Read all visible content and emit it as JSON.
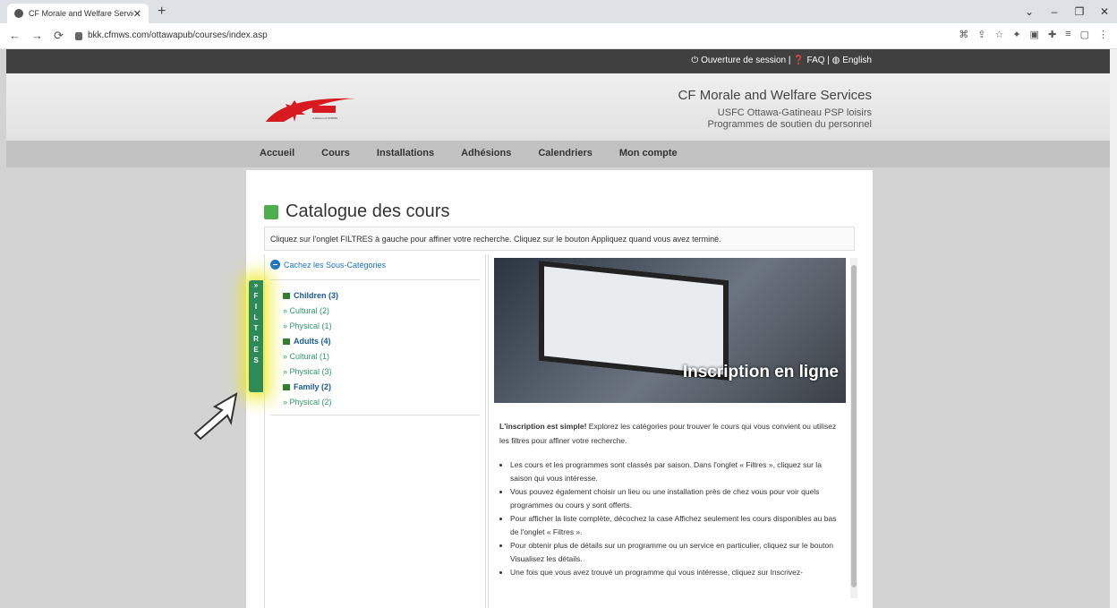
{
  "browser": {
    "tab_title": "CF Morale and Welfare Services",
    "url": "bkk.cfmws.com/ottawapub/courses/index.asp"
  },
  "topbar": {
    "login": "⏻ Ouverture de session",
    "faq": "❓ FAQ",
    "english": "English"
  },
  "header": {
    "org_line1": "CF Morale and Welfare Services",
    "org_line2": "USFC Ottawa-Gatineau PSP loisirs",
    "org_line3": "Programmes de soutien du personnel",
    "logo_small": "A division of CFMWS / Une division des SBMFC"
  },
  "nav": [
    "Accueil",
    "Cours",
    "Installations",
    "Adhésions",
    "Calendriers",
    "Mon compte"
  ],
  "main": {
    "title": "Catalogue des cours",
    "instruction": "Cliquez sur l'onglet FILTRES à gauche pour affiner votre recherche. Cliquez sur le bouton Appliquez quand vous avez terminé.",
    "hide_subcategories": "Cachez les Sous-Catégories",
    "filters_letters": [
      "»",
      "F",
      "I",
      "L",
      "T",
      "R",
      "E",
      "S"
    ],
    "categories": [
      {
        "label": "Children (3)",
        "subs": [
          "» Cultural (2)",
          "» Physical (1)"
        ]
      },
      {
        "label": "Adults (4)",
        "subs": [
          "» Cultural (1)",
          "» Physical (3)"
        ]
      },
      {
        "label": "Family (2)",
        "subs": [
          "» Physical (2)"
        ]
      }
    ],
    "hero_caption": "Inscription en ligne",
    "intro_bold": "L'inscription est simple!",
    "intro_rest": " Explorez les catégories pour trouver le cours qui vous convient ou utilisez les filtres pour affiner votre recherche.",
    "bullets": [
      "Les cours et les programmes sont classés par saison. Dans l'onglet « Filtres », cliquez sur la saison qui vous intéresse.",
      "Vous pouvez également choisir un lieu ou une installation près de chez vous pour voir quels programmes ou cours y sont offerts.",
      "Pour afficher la liste complète, décochez la case Affichez seulement les cours disponibles au bas de l'onglet « Filtres ».",
      "Pour obtenir plus de détails sur un programme ou un service en particulier, cliquez sur le bouton Visualisez les détails.",
      "Une fois que vous avez trouvé un programme qui vous intéresse, cliquez sur Inscrivez-"
    ]
  }
}
